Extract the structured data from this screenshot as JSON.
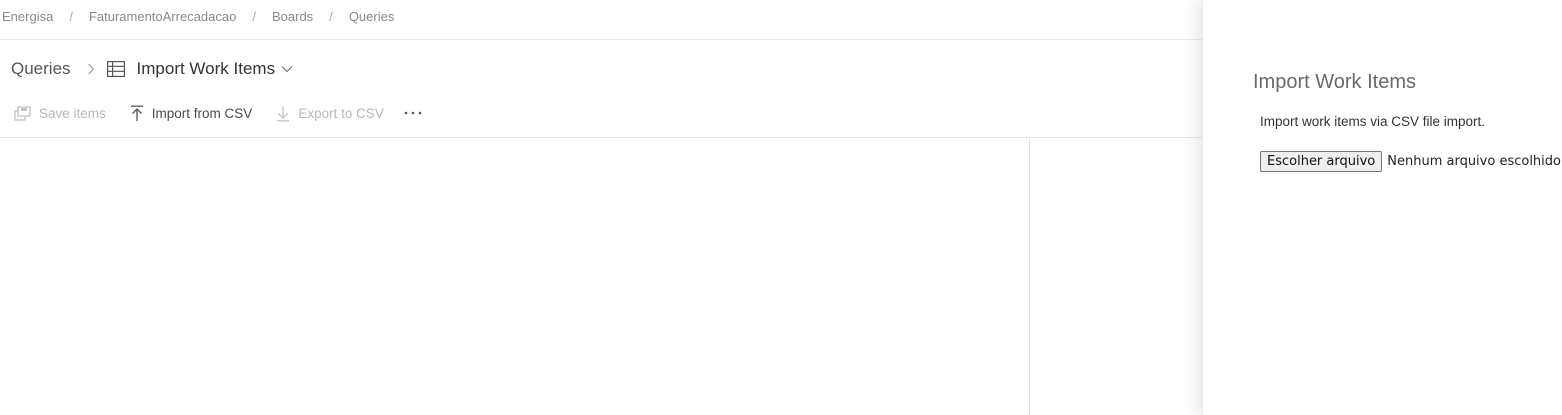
{
  "breadcrumb": {
    "items": [
      "Energisa",
      "FaturamentoArrecadacao",
      "Boards",
      "Queries"
    ],
    "separator": "/"
  },
  "header": {
    "root_label": "Queries",
    "current_label": "Import Work Items"
  },
  "toolbar": {
    "save_label": "Save items",
    "import_label": "Import from CSV",
    "export_label": "Export to CSV"
  },
  "panel": {
    "title": "Import Work Items",
    "description": "Import work items via CSV file import.",
    "file_button_label": "Escolher arquivo",
    "file_status": "Nenhum arquivo escolhido"
  },
  "icons": {
    "breadcrumb_chevron": "chevron-right-icon",
    "query_type": "grid-icon",
    "title_dropdown": "chevron-down-icon",
    "save": "save-icon",
    "import": "upload-icon",
    "export": "download-icon",
    "more": "more-icon"
  },
  "colors": {
    "disabled_text": "#b8b8b8",
    "enabled_text": "#4a4a4a",
    "panel_title": "#6a6a6a"
  }
}
